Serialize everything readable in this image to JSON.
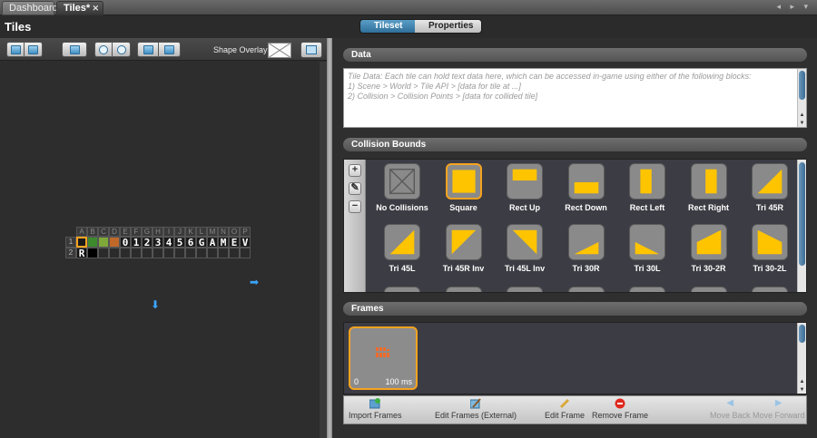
{
  "tabs": [
    {
      "label": "Dashboard"
    },
    {
      "label": "Tiles*",
      "close": "✕"
    }
  ],
  "tab_scroll_arrows": "◂ ▸ ▾",
  "header": {
    "title": "Tiles",
    "segments": [
      "Tileset",
      "Properties"
    ]
  },
  "left_toolbar": {
    "shape_overlay_label": "Shape Overlay"
  },
  "tile_grid": {
    "columns": [
      "A",
      "B",
      "C",
      "D",
      "E",
      "F",
      "G",
      "H",
      "I",
      "J",
      "K",
      "L",
      "M",
      "N",
      "O",
      "P"
    ],
    "rows": [
      "1",
      "2"
    ],
    "row1_chars": [
      "",
      "",
      "",
      "",
      "0",
      "1",
      "2",
      "3",
      "4",
      "5",
      "6",
      "G",
      "A",
      "M",
      "E",
      "V"
    ],
    "row2_chars": [
      "R"
    ],
    "arrow_right": "➡",
    "arrow_down": "⬇"
  },
  "data_section": {
    "title": "Data",
    "placeholder_lines": [
      "Tile Data: Each tile can hold text data here, which can be accessed in-game using either of the following blocks:",
      "1) Scene > World > Tile API > [data for tile at ...]",
      "2) Collision > Collision Points > [data for collided tile]"
    ]
  },
  "collision_section": {
    "title": "Collision Bounds",
    "side_tools": [
      "+",
      "✎",
      "−"
    ],
    "items": [
      {
        "label": "No Collisions",
        "icon": "no-collision-icon"
      },
      {
        "label": "Square",
        "icon": "square-icon"
      },
      {
        "label": "Rect Up",
        "icon": "rect-up-icon"
      },
      {
        "label": "Rect Down",
        "icon": "rect-down-icon"
      },
      {
        "label": "Rect Left",
        "icon": "rect-left-icon"
      },
      {
        "label": "Rect Right",
        "icon": "rect-right-icon"
      },
      {
        "label": "Tri 45R",
        "icon": "tri-45r-icon"
      },
      {
        "label": "Tri 45L",
        "icon": "tri-45l-icon"
      },
      {
        "label": "Tri 45R Inv",
        "icon": "tri-45r-inv-icon"
      },
      {
        "label": "Tri 45L Inv",
        "icon": "tri-45l-inv-icon"
      },
      {
        "label": "Tri 30R",
        "icon": "tri-30r-icon"
      },
      {
        "label": "Tri 30L",
        "icon": "tri-30l-icon"
      },
      {
        "label": "Tri 30-2R",
        "icon": "tri-30-2r-icon"
      },
      {
        "label": "Tri 30-2L",
        "icon": "tri-30-2l-icon"
      }
    ],
    "selected": "Square"
  },
  "frames_section": {
    "title": "Frames",
    "frames": [
      {
        "index": "0",
        "duration": "100 ms"
      }
    ]
  },
  "bottom_bar": {
    "buttons": [
      {
        "label": "Import Frames",
        "enabled": true
      },
      {
        "label": "Edit Frames (External)",
        "enabled": true
      },
      {
        "label": "Edit Frame",
        "enabled": true
      },
      {
        "label": "Remove Frame",
        "enabled": true
      },
      {
        "label": "Move Back",
        "enabled": false
      },
      {
        "label": "Move Forward",
        "enabled": false
      }
    ]
  },
  "colors": {
    "accent": "#f6a31f",
    "collision_fill": "#ffc400",
    "selected_segment": "#3f82ad"
  }
}
